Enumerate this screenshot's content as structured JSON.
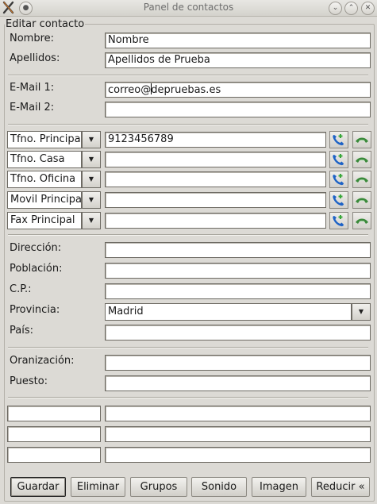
{
  "window": {
    "title": "Panel de contactos"
  },
  "frame": {
    "legend": "Editar contacto"
  },
  "name_section": {
    "nombre_label": "Nombre:",
    "nombre_value": "Nombre",
    "apellidos_label": "Apellidos:",
    "apellidos_value": "Apellidos de Prueba"
  },
  "email_section": {
    "email1_label": "E-Mail 1:",
    "email1_value_a": "correo@",
    "email1_value_b": "depruebas.es",
    "email2_label": "E-Mail 2:",
    "email2_value": ""
  },
  "phones": [
    {
      "type": "Tfno. Principal",
      "value": "9123456789"
    },
    {
      "type": "Tfno. Casa",
      "value": ""
    },
    {
      "type": "Tfno. Oficina",
      "value": ""
    },
    {
      "type": "Movil Principal",
      "value": ""
    },
    {
      "type": "Fax Principal",
      "value": ""
    }
  ],
  "address_section": {
    "direccion_label": "Dirección:",
    "poblacion_label": "Población:",
    "cp_label": "C.P.:",
    "provincia_label": "Provincia:",
    "provincia_value": "Madrid",
    "pais_label": "País:"
  },
  "work_section": {
    "organizacion_label": "Oranización:",
    "puesto_label": "Puesto:"
  },
  "buttons": {
    "guardar": "Guardar",
    "eliminar": "Eliminar",
    "grupos": "Grupos",
    "sonido": "Sonido",
    "imagen": "Imagen",
    "reducir": "Reducir «"
  },
  "icons": {
    "call": "phone-call-icon",
    "hangup": "phone-hangup-icon",
    "dropdown": "chevron-down-icon"
  }
}
